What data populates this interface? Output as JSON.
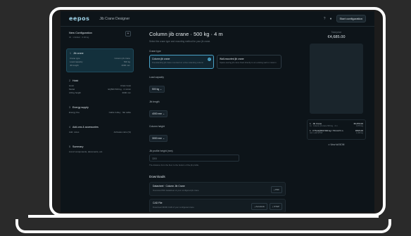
{
  "app": {
    "logo": "eepos",
    "title": "Jib Crane Designer",
    "start_button": "Start configuration"
  },
  "sidebar": {
    "new_config_title": "New Configuration",
    "new_config_sub": "ID · Untitled · 0.00 kg",
    "sections": [
      {
        "num": "1",
        "title": "Jib crane",
        "rows": [
          [
            "Crane type",
            "Column jib crane"
          ],
          [
            "Load capacity",
            "500 kg"
          ],
          [
            "Jib length",
            "4000 mm"
          ]
        ]
      },
      {
        "num": "2",
        "title": "Hoist",
        "rows": [
          [
            "Hoist",
            "Chain hoist"
          ],
          [
            "Model",
            "EQ500 500 kg · 4 m/min"
          ],
          [
            "Lifting height",
            "3000 mm"
          ]
        ]
      },
      {
        "num": "3",
        "title": "Energy supply",
        "rows": [
          [
            "Energy line",
            "Cable trolley · flat cable"
          ]
        ]
      },
      {
        "num": "4",
        "title": "Add-ons & accessories",
        "rows": [
          [
            "Add. notes",
            "Activates ratio (%)"
          ]
        ]
      },
      {
        "num": "5",
        "title": "Summary",
        "rows": [
          [
            "List of components, documents, etc.",
            ""
          ]
        ]
      }
    ]
  },
  "main": {
    "title": "Column jib crane · 500 kg · 4 m",
    "subtitle": "Select the crane type and mounting method for your jib crane.",
    "crane_type_label": "Crane type",
    "choices": [
      {
        "title": "Column jib crane",
        "desc": "Freestanding jib crane mounted on a floor-standing column"
      },
      {
        "title": "Wall-mounted jib crane",
        "desc": "Space-saving jib crane fixed directly to an existing wall or column"
      }
    ],
    "load_label": "Load capacity",
    "load_value": "500 kg",
    "jib_label": "Jib length",
    "jib_value": "4000 mm",
    "column_label": "Column height",
    "column_value": "3000 mm",
    "profile_label": "Jib profile height (mm)",
    "profile_placeholder": "3200",
    "profile_help": "The distance from the floor to the bottom of the jib profile.",
    "downloads_title": "Downloads",
    "downloads": [
      {
        "title": "Datasheet · Column Jib Crane",
        "desc": "Overview PDF datasheet of your configured jib crane",
        "buttons": [
          "PDF"
        ]
      },
      {
        "title": "CAD File",
        "desc": "Download 3D/2D CAD of your configured crane",
        "buttons": [
          "Autodesk",
          "STEP"
        ]
      }
    ]
  },
  "summary": {
    "total_label": "Total price",
    "total_value": "€4,685.00",
    "items": [
      {
        "name": "1 · Jib Crane",
        "price": "€3,870.00",
        "sub_left": "1x · Column jib crane 500 kg · 4 m",
        "sub_right": "3,870 kg"
      },
      {
        "name": "1 · KTS-EQ500 500 kg / TR-C2.5 m",
        "price": "€815.00",
        "sub_left": "Incl. LHD STOP",
        "sub_right": "1,026 kg"
      }
    ],
    "view_all": "View full BOM"
  }
}
